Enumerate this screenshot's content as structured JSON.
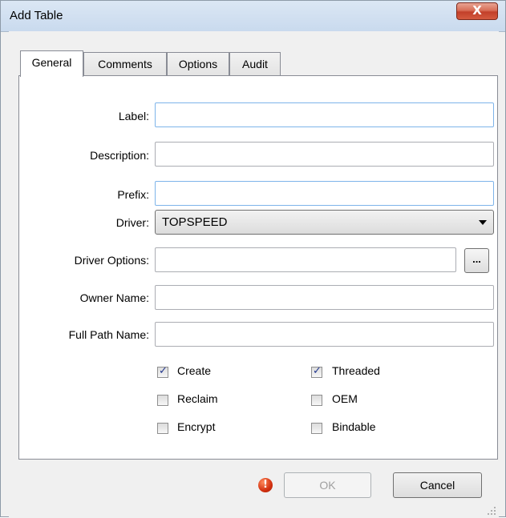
{
  "window": {
    "title": "Add Table",
    "close_label": "X"
  },
  "tabs": [
    {
      "label": "General",
      "active": true
    },
    {
      "label": "Comments",
      "active": false
    },
    {
      "label": "Options",
      "active": false
    },
    {
      "label": "Audit",
      "active": false
    }
  ],
  "form": {
    "label": {
      "label": "Label:",
      "value": ""
    },
    "description": {
      "label": "Description:",
      "value": ""
    },
    "prefix": {
      "label": "Prefix:",
      "value": ""
    },
    "driver": {
      "label": "Driver:",
      "value": "TOPSPEED"
    },
    "driver_options": {
      "label": "Driver Options:",
      "value": "",
      "button_label": "..."
    },
    "owner_name": {
      "label": "Owner Name:",
      "value": ""
    },
    "full_path_name": {
      "label": "Full Path Name:",
      "value": ""
    }
  },
  "checkboxes": {
    "create": {
      "label": "Create",
      "checked": true
    },
    "threaded": {
      "label": "Threaded",
      "checked": true
    },
    "reclaim": {
      "label": "Reclaim",
      "checked": false
    },
    "oem": {
      "label": "OEM",
      "checked": false
    },
    "encrypt": {
      "label": "Encrypt",
      "checked": false
    },
    "bindable": {
      "label": "Bindable",
      "checked": false
    }
  },
  "footer": {
    "warning_icon": "error-icon",
    "warning_glyph": "!",
    "ok_label": "OK",
    "ok_enabled": false,
    "cancel_label": "Cancel"
  },
  "colors": {
    "close_button": "#c2402a",
    "focus_border": "#7eb4ea",
    "check_mark": "#23378e"
  }
}
